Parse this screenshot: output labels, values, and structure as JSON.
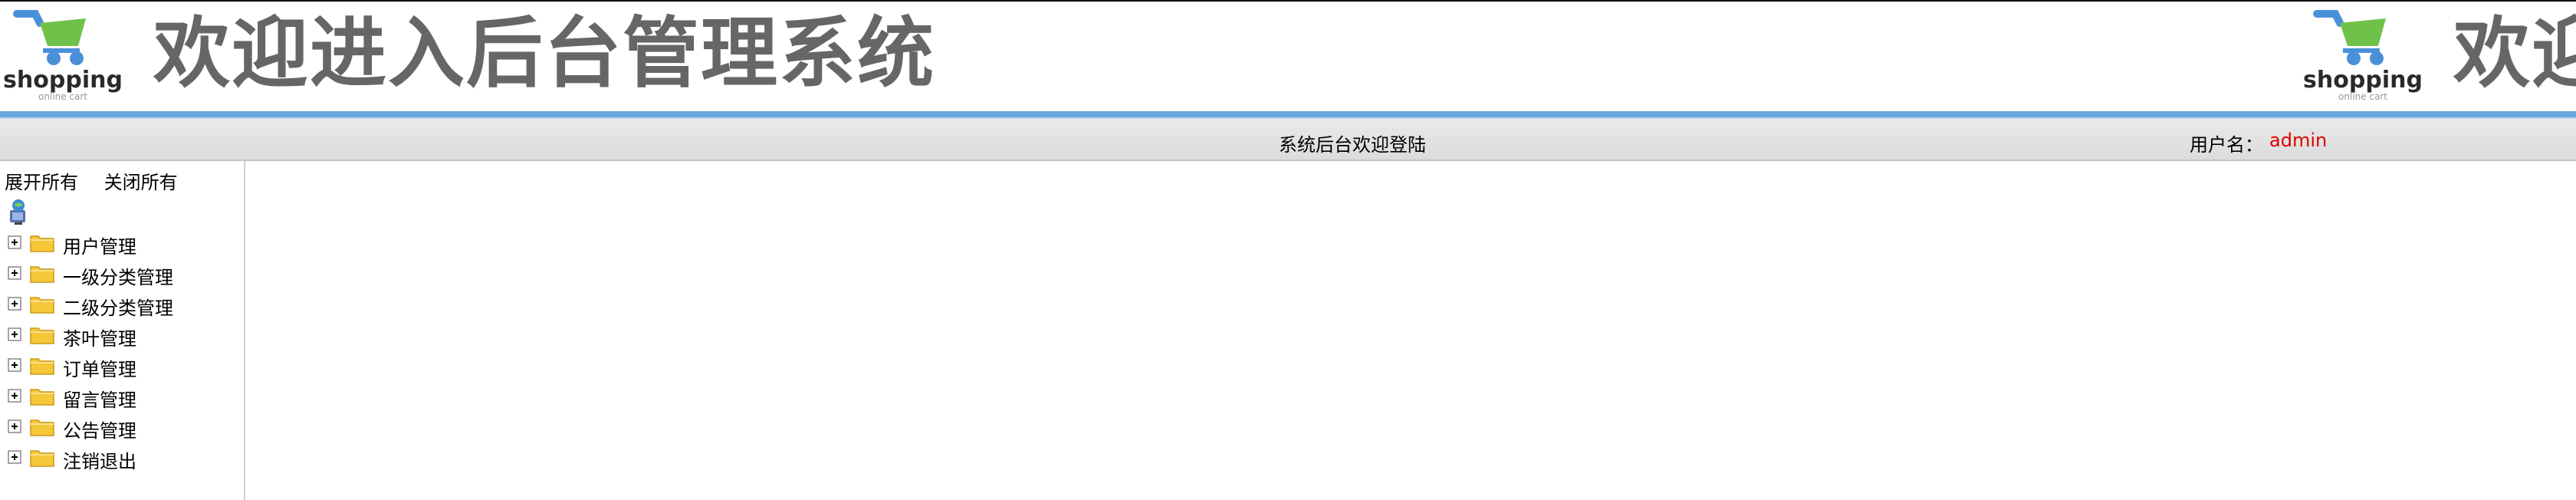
{
  "header": {
    "logo_text": "shopping",
    "logo_subtext": "online cart",
    "banner_title": "欢迎进入后台管理系统",
    "banner_title_repeat": "欢迎",
    "accent_color": "#6aa5dc"
  },
  "statusbar": {
    "welcome": "系统后台欢迎登陆",
    "user_label": "用户名：",
    "username": "admin",
    "username_color": "#e00000"
  },
  "sidebar": {
    "expand_all": "展开所有",
    "collapse_all": "关闭所有",
    "root_icon": "globe-computer-icon",
    "items": [
      {
        "label": "用户管理",
        "icon": "folder-icon"
      },
      {
        "label": "一级分类管理",
        "icon": "folder-icon"
      },
      {
        "label": "二级分类管理",
        "icon": "folder-icon"
      },
      {
        "label": "茶叶管理",
        "icon": "folder-icon"
      },
      {
        "label": "订单管理",
        "icon": "folder-icon"
      },
      {
        "label": "留言管理",
        "icon": "folder-icon"
      },
      {
        "label": "公告管理",
        "icon": "folder-icon"
      },
      {
        "label": "注销退出",
        "icon": "folder-icon"
      }
    ]
  }
}
